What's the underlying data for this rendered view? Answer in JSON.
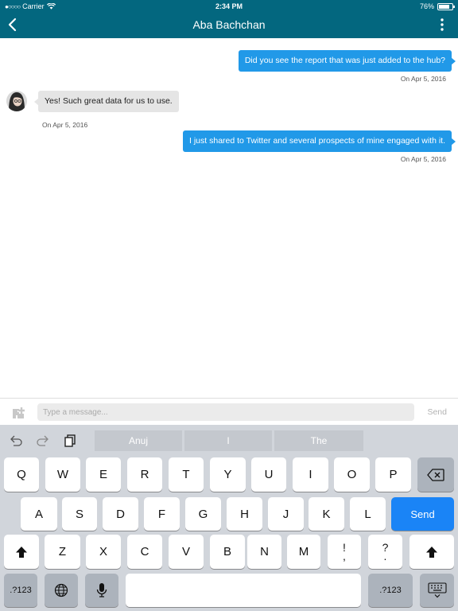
{
  "status_bar": {
    "carrier": "Carrier",
    "signal_dots": "●○○○○",
    "time": "2:34 PM",
    "battery_percent": "76%",
    "battery_level": 0.76
  },
  "nav": {
    "title": "Aba Bachchan",
    "back_icon": "chevron-left-icon",
    "menu_icon": "more-vertical-icon",
    "bar_color": "#03677f"
  },
  "messages": [
    {
      "direction": "out",
      "text": "Did you see the report that was just added to the hub?",
      "timestamp": "On Apr 5, 2016"
    },
    {
      "direction": "in",
      "text": "Yes! Such great data for us to use.",
      "timestamp": "On Apr 5, 2016"
    },
    {
      "direction": "out",
      "text": "I just shared to Twitter and several prospects of mine engaged with it.",
      "timestamp": "On Apr 5, 2016"
    }
  ],
  "composer": {
    "placeholder": "Type a message...",
    "value": "",
    "send_label": "Send",
    "attach_icon": "add-attachment-icon"
  },
  "keyboard": {
    "suggestions": [
      "Anuj",
      "I",
      "The"
    ],
    "row1": [
      "Q",
      "W",
      "E",
      "R",
      "T",
      "Y",
      "U",
      "I",
      "O",
      "P"
    ],
    "row2": [
      "A",
      "S",
      "D",
      "F",
      "G",
      "H",
      "J",
      "K",
      "L"
    ],
    "row3": [
      "Z",
      "X",
      "C",
      "V",
      "B",
      "N",
      "M"
    ],
    "punct1": [
      "!",
      ","
    ],
    "punct2": [
      "?",
      "."
    ],
    "send_label": "Send",
    "numbers_label": ".?123",
    "accent_color": "#1a84f6"
  }
}
